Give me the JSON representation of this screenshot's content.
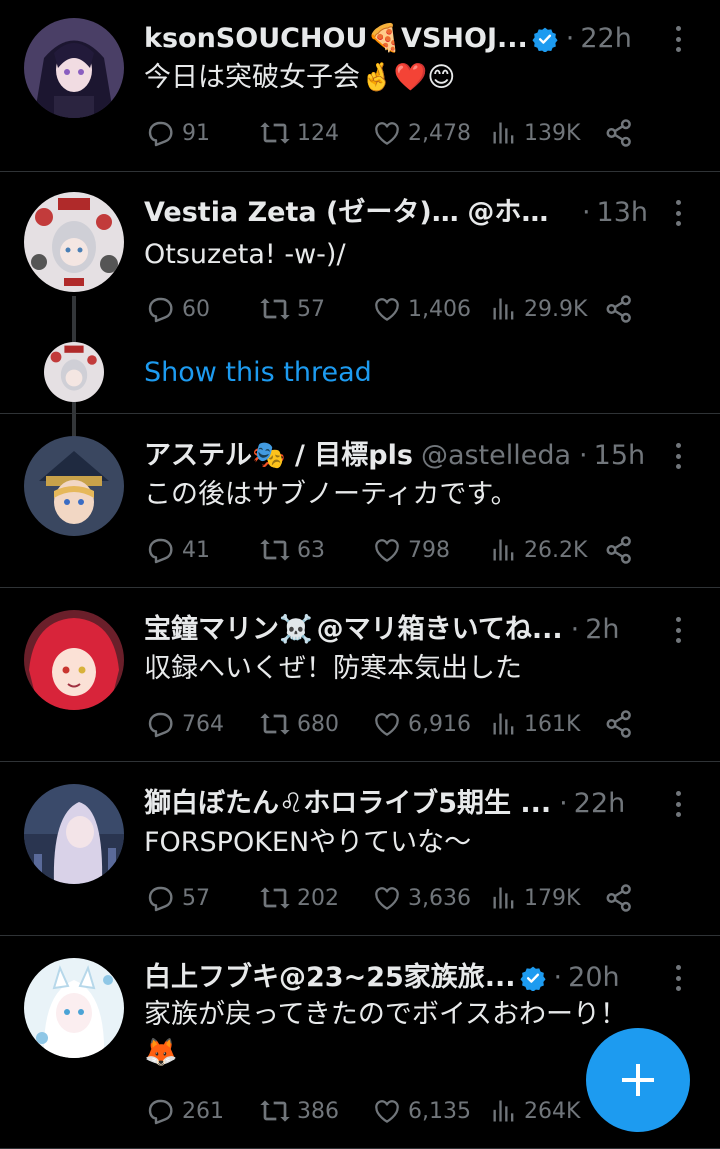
{
  "tweets": [
    {
      "name": "ksonSOUCHOU",
      "name_emoji": "🍕",
      "name_rest": "VSHOJ...",
      "handle": "",
      "time": "22h",
      "text": "今日は突破女子会🤞❤️😊",
      "replies": "91",
      "retweets": "124",
      "likes": "2,478",
      "views": "139K"
    },
    {
      "name": "Vestia Zeta (ゼータ) 📜",
      "handle": "@ホロ...",
      "time": "13h",
      "text": "Otsuzeta! -w-)/",
      "replies": "60",
      "retweets": "57",
      "likes": "1,406",
      "views": "29.9K",
      "show_thread": "Show this thread"
    },
    {
      "name": "アステル🎭 / 目標pls",
      "handle": "@astelleda",
      "time": "15h",
      "text": "この後はサブノーティカです。",
      "replies": "41",
      "retweets": "63",
      "likes": "798",
      "views": "26.2K"
    },
    {
      "name": "宝鐘マリン☠️",
      "handle": "@マリ箱きいてね...",
      "time": "2h",
      "text": "収録へいくぜ！防寒本気出した",
      "replies": "764",
      "retweets": "680",
      "likes": "6,916",
      "views": "161K"
    },
    {
      "name": "獅白ぼたん♌ホロライブ5期生 ...",
      "handle": "",
      "time": "22h",
      "text": "FORSPOKENやりていな～",
      "replies": "57",
      "retweets": "202",
      "likes": "3,636",
      "views": "179K"
    },
    {
      "name": "白上フブキ@23~25家族旅...",
      "handle": "",
      "time": "20h",
      "text": "家族が戻ってきたのでボイスおわーり！",
      "text2": "🦊",
      "replies": "261",
      "retweets": "386",
      "likes": "6,135",
      "views": "264K"
    }
  ],
  "icons": {
    "reply": "reply-icon",
    "retweet": "retweet-icon",
    "like": "heart-icon",
    "views": "views-icon",
    "share": "share-icon",
    "compose": "plus-icon",
    "verified": "verified-icon",
    "more": "more-icon"
  },
  "colors": {
    "background": "#000000",
    "text": "#e7e9ea",
    "muted": "#71767b",
    "accent": "#1d9bf0",
    "divider": "#2f3336"
  }
}
